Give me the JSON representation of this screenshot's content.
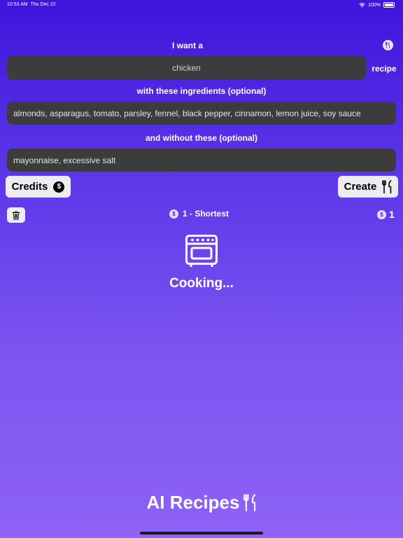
{
  "status_bar": {
    "time": "10:53 AM",
    "date": "Thu Dec 22",
    "battery": "100%"
  },
  "form": {
    "want_label": "I want a",
    "dish_value": "chicken",
    "recipe_suffix": "recipe",
    "with_label": "with these ingredients (optional)",
    "with_value": "almonds, asparagus, tomato, parsley, fennel, black pepper, cinnamon, lemon juice, soy sauce",
    "without_label": "and without these (optional)",
    "without_value": "mayonnaise, excessive salt"
  },
  "buttons": {
    "credits": "Credits",
    "create": "Create"
  },
  "options": {
    "length_label": "1 - Shortest",
    "credit_count": "1",
    "coin_symbol": "$"
  },
  "status": {
    "cooking": "Cooking..."
  },
  "footer": {
    "app_title": "AI Recipes"
  },
  "icons": [
    "fork-knife-icon",
    "dollar-coin-icon",
    "trash-icon",
    "oven-icon",
    "wifi-icon",
    "battery-icon"
  ],
  "colors": {
    "gradient_top": "#3f14dc",
    "gradient_bottom": "#8e62f5",
    "field_bg": "#3c3c3e",
    "button_bg": "#ececf1"
  }
}
